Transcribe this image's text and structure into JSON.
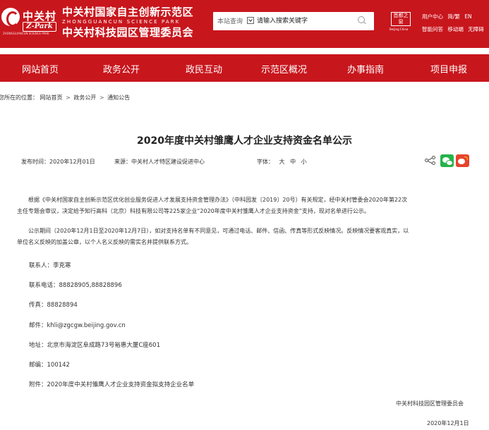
{
  "header": {
    "logo": {
      "cn": "中关村",
      "badge": "Z-Park",
      "tag": "ZHONGGUANCUN SCIENCE PARK"
    },
    "org_line1": "中关村国家自主创新示范区",
    "org_en": "ZHONGGUANCUN SCIENCE PARK",
    "org_line2": "中关村科技园区管理委员会",
    "search": {
      "scope": "本站查询",
      "placeholder": "请输入搜索关键字"
    },
    "capital": {
      "text": "首都之窗",
      "en": "Beijing China"
    },
    "top_links_row1": [
      "用户中心",
      "简/繁",
      "EN"
    ],
    "top_links_row2": [
      "智能问答",
      "移动端",
      "无障碍"
    ]
  },
  "nav": {
    "items": [
      "网站首页",
      "政务公开",
      "政民互动",
      "示范区概况",
      "办事指南",
      "项目申报"
    ]
  },
  "breadcrumb": {
    "label": "您所在的位置：",
    "items": [
      "网站首页",
      "政务公开",
      "通知公告"
    ],
    "separator": ">"
  },
  "article": {
    "title": "2020年度中关村雏鹰人才企业支持资金名单公示",
    "publish_time": "发布时间：2020年12月01日",
    "source": "来源：中关村人才特区建设促进中心",
    "font_label": "字体：",
    "font_sizes": [
      "大",
      "中",
      "小"
    ],
    "paragraph1_line1": "根据《中关村国家自主创新示范区优化创业服务促进人才发展支持资金管理办法》（中科园发〔2019〕20号）有关规定，经中关村管委会2020年第22次",
    "paragraph1_line2": "主任专题会审议，决定给予知行高科（北京）科技有限公司等225家企业“2020年度中关村雏鹰人才企业支持资金”支持，现对名单进行公示。",
    "paragraph2_line1": "公示期间（2020年12月1日至2020年12月7日），如对支持名单有不同意见，可通过电话、邮件、信函、传真等形式反映情况。反映情况要客观真实，以",
    "paragraph2_line2": "单位名义反映的加盖公章，以个人名义反映的需实名并提供联系方式。",
    "contact": "联系人：李克寒",
    "phone": "联系电话：88828905,88828896",
    "fax": "传真：88828894",
    "email": "邮件：khli@zgcgw.beijing.gov.cn",
    "address": "地址：北京市海淀区阜成路73号裕惠大厦C座601",
    "postcode": "邮编：100142",
    "attachment": "附件：2020年度中关村雏鹰人才企业支持资金拟支持企业名单",
    "signature_org": "中关村科技园区管理委员会",
    "signature_date": "2020年12月1日"
  },
  "colors": {
    "brand_red": "#c8161d",
    "wechat_green": "#25b34a",
    "weibo_red": "#e6442e"
  }
}
